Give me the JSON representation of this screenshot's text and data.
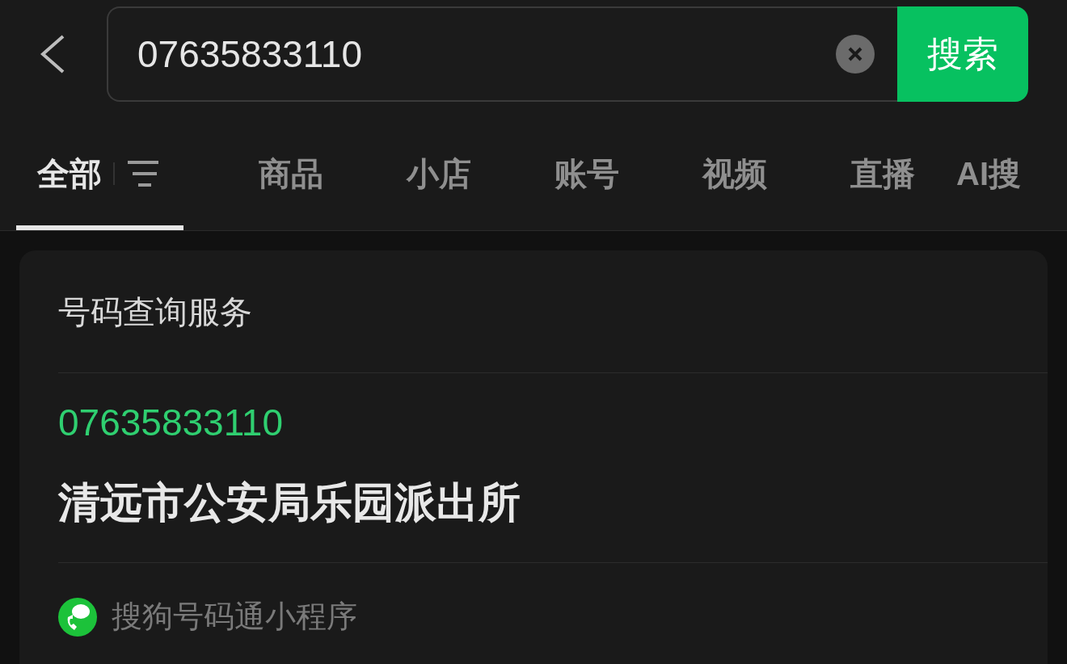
{
  "search": {
    "value": "07635833110",
    "button": "搜索"
  },
  "tabs": [
    {
      "label": "全部",
      "selected": true,
      "filter": true
    },
    {
      "label": "商品",
      "selected": false
    },
    {
      "label": "小店",
      "selected": false
    },
    {
      "label": "账号",
      "selected": false
    },
    {
      "label": "视频",
      "selected": false
    },
    {
      "label": "直播",
      "selected": false
    },
    {
      "label": "AI搜",
      "selected": false
    }
  ],
  "card": {
    "title": "号码查询服务",
    "number": "07635833110",
    "name": "清远市公安局乐园派出所",
    "source": "搜狗号码通小程序"
  }
}
